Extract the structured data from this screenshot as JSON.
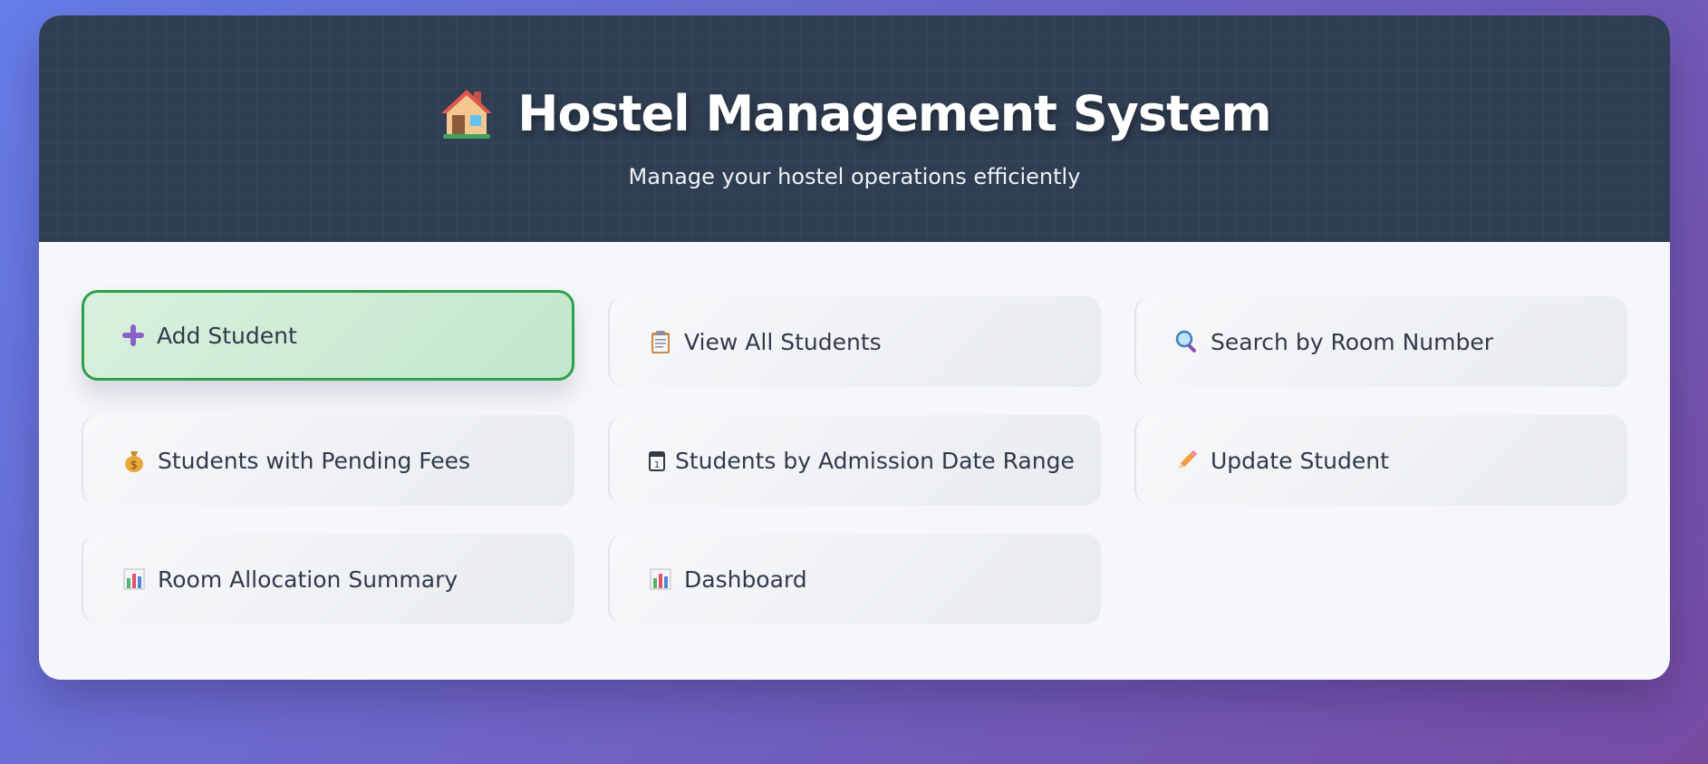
{
  "header": {
    "icon": "house-icon",
    "title": "Hostel Management System",
    "subtitle": "Manage your hostel operations efficiently"
  },
  "menu": [
    {
      "label": "Add Student",
      "icon": "plus-icon",
      "active": true
    },
    {
      "label": "View All Students",
      "icon": "clipboard-icon",
      "active": false
    },
    {
      "label": "Search by Room Number",
      "icon": "magnifier-icon",
      "active": false
    },
    {
      "label": "Students with Pending Fees",
      "icon": "money-bag-icon",
      "active": false
    },
    {
      "label": "Students by Admission Date Range",
      "icon": "calendar-icon",
      "active": false
    },
    {
      "label": "Update Student",
      "icon": "pencil-icon",
      "active": false
    },
    {
      "label": "Room Allocation Summary",
      "icon": "bar-chart-icon",
      "active": false
    },
    {
      "label": "Dashboard",
      "icon": "bar-chart-icon",
      "active": false
    }
  ],
  "colors": {
    "background_start": "#667eea",
    "background_end": "#764ba2",
    "header_bg": "#2f3e52",
    "active_border": "#2ea148",
    "active_bg": "#d8f1dc",
    "text": "#2f3a4c"
  }
}
